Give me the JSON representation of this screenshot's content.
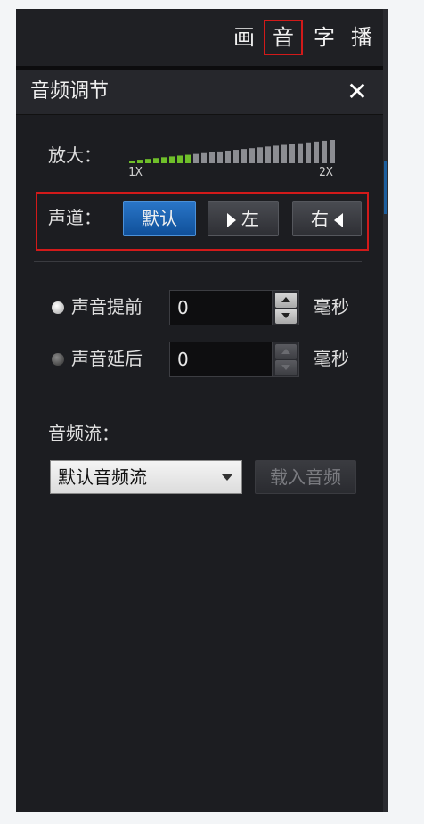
{
  "tabs": [
    {
      "label": "画",
      "active": false
    },
    {
      "label": "音",
      "active": true
    },
    {
      "label": "字",
      "active": false
    },
    {
      "label": "播",
      "active": false
    }
  ],
  "panel": {
    "title": "音频调节",
    "close_label": "✕"
  },
  "zoom": {
    "label": "放大：",
    "min_label": "1X",
    "max_label": "2X",
    "level_fraction": 0.3
  },
  "channel": {
    "label": "声道：",
    "buttons": [
      "默认",
      "左",
      "右"
    ],
    "selected": "默认"
  },
  "sync": {
    "advance_label": "声音提前",
    "advance_value": "0",
    "delay_label": "声音延后",
    "delay_value": "0",
    "unit": "毫秒",
    "selected": "advance"
  },
  "audio_stream": {
    "label": "音频流：",
    "selected": "默认音频流",
    "load_button": "载入音频"
  },
  "colors": {
    "highlight_red": "#d21a1a",
    "selected_blue": "#0f4f99",
    "slider_green": "#6fbf2a"
  }
}
